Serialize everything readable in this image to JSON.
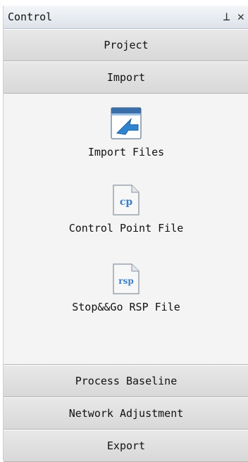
{
  "panel": {
    "title": "Control",
    "pin_glyph": "⊥",
    "close_glyph": "✕"
  },
  "sections": {
    "project": "Project",
    "import": "Import",
    "process_baseline": "Process Baseline",
    "network_adjustment": "Network Adjustment",
    "export": "Export"
  },
  "import_tools": [
    {
      "label": "Import Files",
      "icon": "import-files-icon"
    },
    {
      "label": "Control Point File",
      "icon": "cp-file-icon",
      "badge": "cp"
    },
    {
      "label": "Stop&&Go RSP File",
      "icon": "rsp-file-icon",
      "badge": "rsp"
    }
  ],
  "colors": {
    "accent_blue": "#3a7fc6",
    "title_bar": "#dde3ea"
  }
}
